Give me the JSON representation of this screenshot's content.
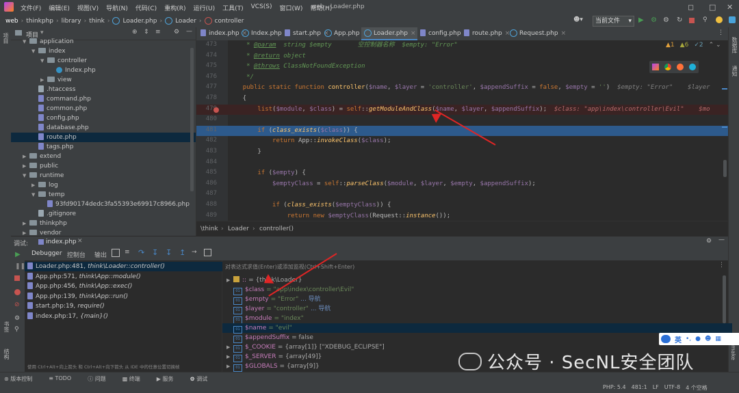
{
  "menubar": {
    "items": [
      "文件(F)",
      "编辑(E)",
      "视图(V)",
      "导航(N)",
      "代码(C)",
      "重构(R)",
      "运行(U)",
      "工具(T)",
      "VCS(S)",
      "窗口(W)",
      "帮助(H)"
    ],
    "title": "web - Loader.php"
  },
  "navbar": {
    "crumbs": [
      "web",
      "thinkphp",
      "library",
      "think",
      "Loader.php",
      "Loader",
      "controller"
    ],
    "run_config": "当前文件"
  },
  "project": {
    "label": "项目",
    "side_label": "项目",
    "tree": [
      {
        "label": "application",
        "type": "folder",
        "depth": 1,
        "open": true
      },
      {
        "label": "index",
        "type": "folder",
        "depth": 2,
        "open": true
      },
      {
        "label": "controller",
        "type": "folder",
        "depth": 3,
        "open": true
      },
      {
        "label": "Index.php",
        "type": "cls",
        "depth": 4
      },
      {
        "label": "view",
        "type": "folder",
        "depth": 3,
        "open": false
      },
      {
        "label": ".htaccess",
        "type": "file",
        "depth": 2
      },
      {
        "label": "command.php",
        "type": "php",
        "depth": 2
      },
      {
        "label": "common.php",
        "type": "php",
        "depth": 2
      },
      {
        "label": "config.php",
        "type": "php",
        "depth": 2
      },
      {
        "label": "database.php",
        "type": "php",
        "depth": 2
      },
      {
        "label": "route.php",
        "type": "php",
        "depth": 2,
        "selected": true
      },
      {
        "label": "tags.php",
        "type": "php",
        "depth": 2
      },
      {
        "label": "extend",
        "type": "folder",
        "depth": 1,
        "open": false
      },
      {
        "label": "public",
        "type": "folder",
        "depth": 1,
        "open": false
      },
      {
        "label": "runtime",
        "type": "folder",
        "depth": 1,
        "open": true
      },
      {
        "label": "log",
        "type": "folder",
        "depth": 2,
        "open": false
      },
      {
        "label": "temp",
        "type": "folder",
        "depth": 2,
        "open": true
      },
      {
        "label": "93fd90174dedc3fa55393e69917c8966.php",
        "type": "php",
        "depth": 3
      },
      {
        "label": ".gitignore",
        "type": "file",
        "depth": 2
      },
      {
        "label": "thinkphp",
        "type": "folder",
        "depth": 1,
        "open": false
      },
      {
        "label": "vendor",
        "type": "folder",
        "depth": 1,
        "open": false
      }
    ]
  },
  "tabs": [
    "index.php",
    "Index.php",
    "start.php",
    "App.php",
    "Loader.php",
    "config.php",
    "route.php",
    "Request.php"
  ],
  "active_tab": "Loader.php",
  "inspections": {
    "warnings": "1",
    "weak": "6",
    "typos": "2"
  },
  "editor": {
    "lines": [
      {
        "n": "473",
        "html": "     <span class='cm'>* <u>@param</u>  string $empty       空控制器名称  $empty: \"Error\"</span>"
      },
      {
        "n": "474",
        "html": "     <span class='cm'>* <u>@return</u> object</span>"
      },
      {
        "n": "475",
        "html": "     <span class='cm'>* <u>@throws</u> ClassNotFoundException</span>"
      },
      {
        "n": "476",
        "html": "     <span class='cm'>*/</span>"
      },
      {
        "n": "477",
        "html": "    <span class='kw'>public static function</span> <span class='fn'>controller</span>(<span class='var'>$name</span>, <span class='var'>$layer</span> = <span class='str'>'controller'</span>, <span class='var'>$appendSuffix</span> = <span class='kw'>false</span>, <span class='var'>$empty</span> = <span class='str'>''</span>)  <span class='dbg'>$empty: \"Error\"    $layer</span>"
      },
      {
        "n": "478",
        "html": "    {"
      },
      {
        "n": "479",
        "html": "        <span class='kw'>list</span>(<span class='var'>$module</span>, <span class='var'>$class</span>) = <span class='kw'>self</span>::<span class='it'>getModuleAndClass</span>(<span class='var'>$name</span>, <span class='var'>$layer</span>, <span class='var'>$appendSuffix</span>);  <span class='dbgr'>$class: \"app\\index\\controller\\Evil\"    $mo</span>",
        "bp": true
      },
      {
        "n": "480",
        "html": ""
      },
      {
        "n": "481",
        "html": "        <span class='kw'>if</span> (<span class='fn' style='font-style:italic'>class_exists</span>(<span class='var'>$class</span>)) {",
        "cur": true
      },
      {
        "n": "482",
        "html": "            <span class='kw'>return</span> App::<span class='it'>invokeClass</span>(<span class='var'>$class</span>);"
      },
      {
        "n": "483",
        "html": "        }"
      },
      {
        "n": "484",
        "html": ""
      },
      {
        "n": "485",
        "html": "        <span class='kw'>if</span> (<span class='var'>$empty</span>) {"
      },
      {
        "n": "486",
        "html": "            <span class='var'>$emptyClass</span> = <span class='kw'>self</span>::<span class='it'>parseClass</span>(<span class='var'>$module</span>, <span class='var'>$layer</span>, <span class='var'>$empty</span>, <span class='var'>$appendSuffix</span>);"
      },
      {
        "n": "487",
        "html": ""
      },
      {
        "n": "488",
        "html": "            <span class='kw'>if</span> (<span class='fn' style='font-style:italic'>class_exists</span>(<span class='var'>$emptyClass</span>)) {"
      },
      {
        "n": "489",
        "html": "                <span class='kw'>return new</span> <span class='var'>$emptyClass</span>(Request::<span class='it'>instance</span>());"
      }
    ],
    "breadcrumb": [
      "\\think",
      "Loader",
      "controller()"
    ]
  },
  "debug": {
    "label": "调试:",
    "session_tab": "index.php",
    "tool_tabs": [
      "Debugger",
      "控制台",
      "输出"
    ],
    "frames": [
      {
        "file": "Loader.php:481,",
        "fn": "think\\Loader::controller()",
        "selected": true
      },
      {
        "file": "App.php:571,",
        "fn": "think\\App::module()"
      },
      {
        "file": "App.php:456,",
        "fn": "think\\App::exec()"
      },
      {
        "file": "App.php:139,",
        "fn": "think\\App::run()"
      },
      {
        "file": "start.php:19,",
        "fn": "require()"
      },
      {
        "file": "index.php:17,",
        "fn": "{main}()"
      }
    ],
    "frames_hint": "使用 Ctrl+Alt+向上箭头 和 Ctrl+Alt+向下箭头 从 IDE 中的任意位置切换帧",
    "eval_placeholder": "对表达式求值(Enter)或添加监视(Ctrl+Shift+Enter)",
    "vars": [
      {
        "name": "::",
        "value": "= {think\\Loader}",
        "static": true
      },
      {
        "name": "$class",
        "value": "= \"app\\index\\controller\\Evil\""
      },
      {
        "name": "$empty",
        "value": "= \"Error\"",
        "nav": "... 导航"
      },
      {
        "name": "$layer",
        "value": "= \"controller\"",
        "nav": "... 导航"
      },
      {
        "name": "$module",
        "value": "= \"index\""
      },
      {
        "name": "$name",
        "value": "= \"evil\"",
        "selected": true
      },
      {
        "name": "$appendSuffix",
        "value": "= false"
      },
      {
        "name": "$_COOKIE",
        "value": "= {array[1]} [\"XDEBUG_ECLIPSE\"]",
        "expand": true
      },
      {
        "name": "$_SERVER",
        "value": "= {array[49]}",
        "expand": true
      },
      {
        "name": "$GLOBALS",
        "value": "= {array[9]}",
        "expand": true
      }
    ]
  },
  "statusbar": {
    "tabs": [
      "版本控制",
      "TODO",
      "问题",
      "终端",
      "服务",
      "调试"
    ],
    "right": [
      "PHP: 5.4",
      "481:1",
      "LF",
      "UTF-8",
      "4 个空格"
    ]
  },
  "ime": {
    "lang": "英"
  },
  "watermark": "公众号 · SecNL安全团队",
  "colors": {
    "accent": "#4a88c7",
    "selection": "#2d5a8c",
    "breakpoint": "#c75450",
    "arrow": "#e02525"
  }
}
